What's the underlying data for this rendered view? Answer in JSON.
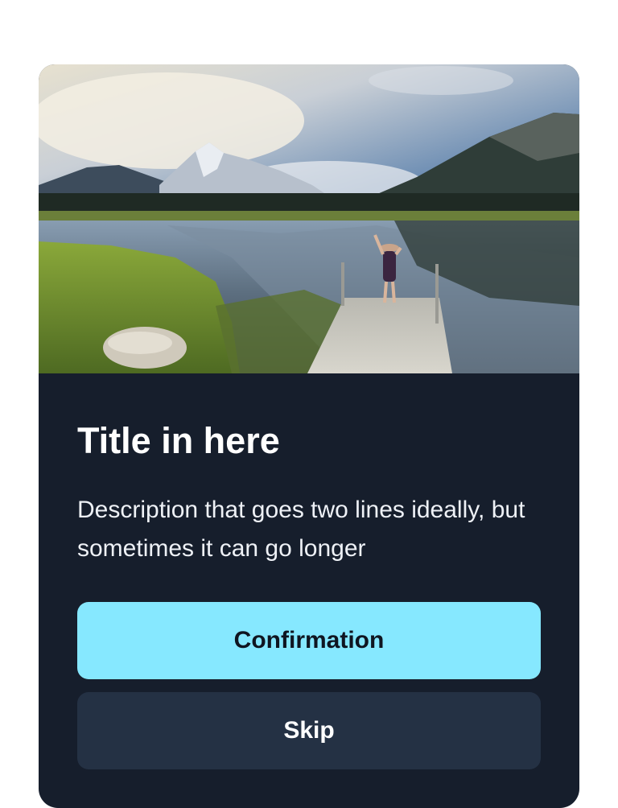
{
  "card": {
    "title": "Title in here",
    "description": "Description that goes two lines ideally, but sometimes it can go longer",
    "primary_button": "Confirmation",
    "secondary_button": "Skip"
  },
  "colors": {
    "card_background": "#161e2c",
    "primary_button": "#86e8ff",
    "secondary_button": "#243144",
    "title_text": "#ffffff"
  },
  "hero_image": {
    "subject": "mountain-lake-dock-photo"
  }
}
